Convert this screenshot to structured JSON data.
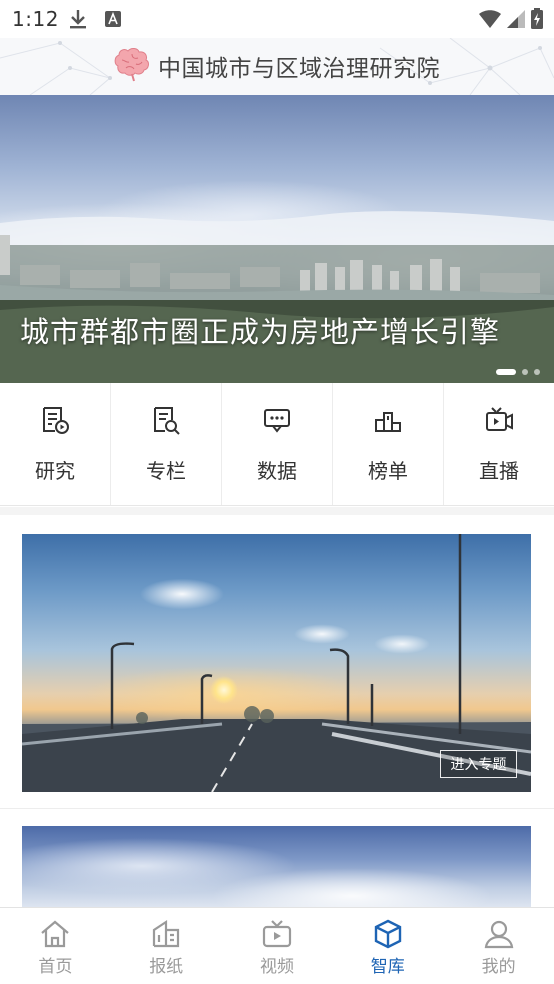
{
  "status_bar": {
    "time": "1:12",
    "icons": [
      "download-icon",
      "a-notification-icon",
      "wifi-icon",
      "signal-icon",
      "battery-charging-icon"
    ]
  },
  "header": {
    "brand_name": "中国城市与区域治理研究院",
    "logo_icon": "brain-logo-icon"
  },
  "banner": {
    "title": "城市群都市圈正成为房地产增长引擎",
    "slide_count": 3,
    "active_slide": 1
  },
  "quick_nav": [
    {
      "label": "研究",
      "icon": "document-play-icon"
    },
    {
      "label": "专栏",
      "icon": "document-search-icon"
    },
    {
      "label": "数据",
      "icon": "chat-bubble-icon"
    },
    {
      "label": "榜单",
      "icon": "podium-icon"
    },
    {
      "label": "直播",
      "icon": "live-video-icon"
    }
  ],
  "feature": {
    "enter_label": "进入专题"
  },
  "tabbar": {
    "items": [
      {
        "label": "首页",
        "icon": "home-icon",
        "active": false
      },
      {
        "label": "报纸",
        "icon": "newspaper-icon",
        "active": false
      },
      {
        "label": "视频",
        "icon": "tv-icon",
        "active": false
      },
      {
        "label": "智库",
        "icon": "cube-icon",
        "active": true
      },
      {
        "label": "我的",
        "icon": "user-icon",
        "active": false
      }
    ],
    "active_color": "#1e64b4",
    "inactive_color": "#9a9a9a"
  }
}
